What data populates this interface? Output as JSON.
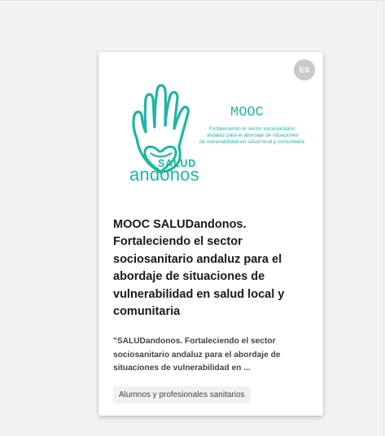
{
  "card": {
    "language_badge": "ES",
    "banner": {
      "logo_word_top": "SALUD",
      "logo_word_bottom": "andonos",
      "mooc_label": "MOOC",
      "subtitle_lines": [
        "Fortaleciendo el sector sociosanitario",
        "andaluz para el abordaje de situaciones",
        "de vulnerabilidad en salud local y comunitaria"
      ],
      "brand_color": "#1fb5a3"
    },
    "title": "MOOC SALUDandonos. Fortaleciendo el sector sociosanitario andaluz para el abordaje de situaciones de vulnerabilidad en salud local y comunitaria",
    "description": "\"SALUDandonos. Fortaleciendo el sector sociosanitario andaluz para el abordaje de situaciones de vulnerabilidad en ...",
    "tag": "Alumnos y profesionales sanitarios"
  }
}
